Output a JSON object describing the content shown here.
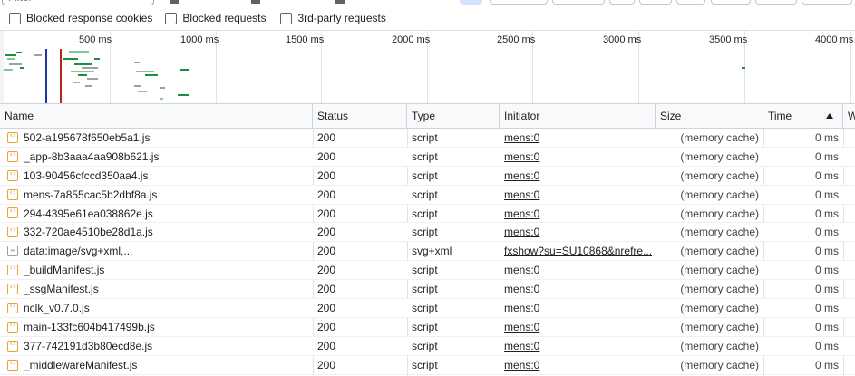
{
  "toolbar": {
    "filter_placeholder": "Filter"
  },
  "checkboxes": [
    {
      "label": "Blocked response cookies",
      "checked": false
    },
    {
      "label": "Blocked requests",
      "checked": false
    },
    {
      "label": "3rd-party requests",
      "checked": false
    }
  ],
  "overview": {
    "ticks": [
      "500 ms",
      "1000 ms",
      "1500 ms",
      "2000 ms",
      "2500 ms",
      "3000 ms",
      "3500 ms",
      "4000 ms"
    ]
  },
  "table": {
    "columns": [
      "Name",
      "Status",
      "Type",
      "Initiator",
      "Size",
      "Time",
      "W"
    ],
    "sorted_column": "Time",
    "sort_direction": "ascending",
    "rows": [
      {
        "name": "502-a195678f650eb5a1.js",
        "status": "200",
        "type": "script",
        "initiator": "mens:0",
        "size": "(memory cache)",
        "time": "0 ms",
        "icon": "script-file-icon"
      },
      {
        "name": "_app-8b3aaa4aa908b621.js",
        "status": "200",
        "type": "script",
        "initiator": "mens:0",
        "size": "(memory cache)",
        "time": "0 ms",
        "icon": "script-file-icon"
      },
      {
        "name": "103-90456cfccd350aa4.js",
        "status": "200",
        "type": "script",
        "initiator": "mens:0",
        "size": "(memory cache)",
        "time": "0 ms",
        "icon": "script-file-icon"
      },
      {
        "name": "mens-7a855cac5b2dbf8a.js",
        "status": "200",
        "type": "script",
        "initiator": "mens:0",
        "size": "(memory cache)",
        "time": "0 ms",
        "icon": "script-file-icon"
      },
      {
        "name": "294-4395e61ea038862e.js",
        "status": "200",
        "type": "script",
        "initiator": "mens:0",
        "size": "(memory cache)",
        "time": "0 ms",
        "icon": "script-file-icon"
      },
      {
        "name": "332-720ae4510be28d1a.js",
        "status": "200",
        "type": "script",
        "initiator": "mens:0",
        "size": "(memory cache)",
        "time": "0 ms",
        "icon": "script-file-icon"
      },
      {
        "name": "data:image/svg+xml,...",
        "status": "200",
        "type": "svg+xml",
        "initiator": "fxshow?su=SU10868&nrefre...",
        "size": "(memory cache)",
        "time": "0 ms",
        "icon": "image-file-icon"
      },
      {
        "name": "_buildManifest.js",
        "status": "200",
        "type": "script",
        "initiator": "mens:0",
        "size": "(memory cache)",
        "time": "0 ms",
        "icon": "script-file-icon"
      },
      {
        "name": "_ssgManifest.js",
        "status": "200",
        "type": "script",
        "initiator": "mens:0",
        "size": "(memory cache)",
        "time": "0 ms",
        "icon": "script-file-icon"
      },
      {
        "name": "nclk_v0.7.0.js",
        "status": "200",
        "type": "script",
        "initiator": "mens:0",
        "size": "(memory cache)",
        "time": "0 ms",
        "icon": "script-file-icon"
      },
      {
        "name": "main-133fc604b417499b.js",
        "status": "200",
        "type": "script",
        "initiator": "mens:0",
        "size": "(memory cache)",
        "time": "0 ms",
        "icon": "script-file-icon"
      },
      {
        "name": "377-742191d3b80ecd8e.js",
        "status": "200",
        "type": "script",
        "initiator": "mens:0",
        "size": "(memory cache)",
        "time": "0 ms",
        "icon": "script-file-icon"
      },
      {
        "name": "_middlewareManifest.js",
        "status": "200",
        "type": "script",
        "initiator": "mens:0",
        "size": "(memory cache)",
        "time": "0 ms",
        "icon": "script-file-icon"
      }
    ]
  }
}
